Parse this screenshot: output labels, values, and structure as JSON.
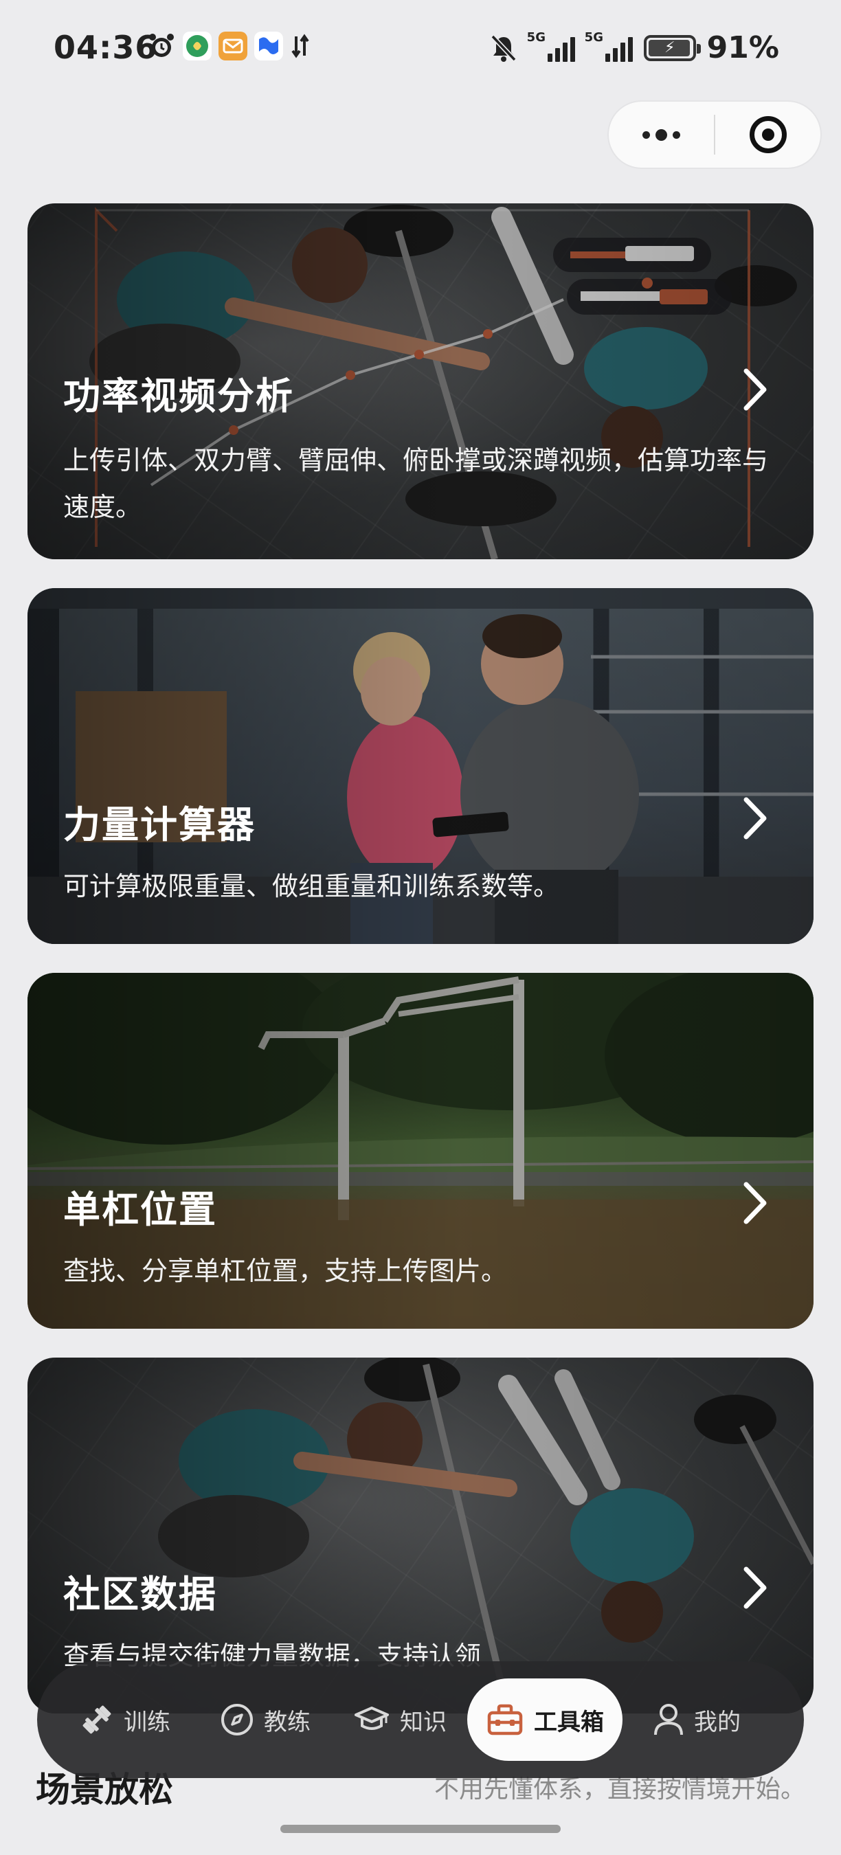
{
  "status_bar": {
    "time": "04:36",
    "battery_text": "91%",
    "signal_labels": [
      "5G",
      "5G"
    ],
    "icons_left": [
      "alarm-icon",
      "app-notification-icon",
      "mail-icon",
      "flag-icon",
      "data-transfer-icon"
    ],
    "icons_right": [
      "mute-icon",
      "signal-icon",
      "signal-icon",
      "battery-charging-icon"
    ]
  },
  "capsule": {
    "icons": [
      "more-dots-icon",
      "close-target-icon"
    ]
  },
  "cards": [
    {
      "title": "功率视频分析",
      "description": "上传引体、双力臂、臂屈伸、俯卧撑或深蹲视频，估算功率与速度。"
    },
    {
      "title": "力量计算器",
      "description": "可计算极限重量、做组重量和训练系数等。"
    },
    {
      "title": "单杠位置",
      "description": "查找、分享单杠位置，支持上传图片。"
    },
    {
      "title": "社区数据",
      "description": "查看与提交街健力量数据，支持认领"
    }
  ],
  "tabbar": {
    "tabs": [
      {
        "label": "训练",
        "icon": "dumbbell-icon"
      },
      {
        "label": "教练",
        "icon": "compass-icon"
      },
      {
        "label": "知识",
        "icon": "graduation-cap-icon"
      },
      {
        "label": "工具箱",
        "icon": "toolbox-icon",
        "active": true
      },
      {
        "label": "我的",
        "icon": "user-icon"
      }
    ]
  },
  "section": {
    "title": "场景放松",
    "subtitle": "不用先懂体系，直接按情境开始。"
  },
  "colors": {
    "background": "#ececee",
    "tabbar_bg": "#28282a",
    "active_tab_bg": "#fbfbfb",
    "accent_orange": "#c8613e"
  }
}
